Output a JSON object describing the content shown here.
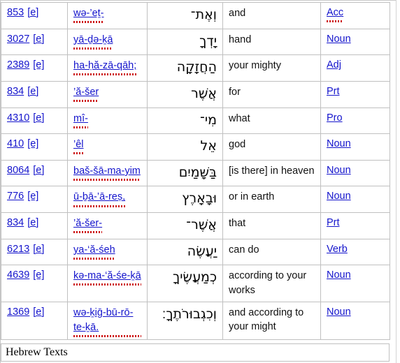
{
  "document": {
    "title": "Hebrew Texts",
    "footer_label": "Hebrew Texts"
  },
  "colors": {
    "link": "#1414CC",
    "text": "#000000",
    "border": "#C0C0C0",
    "spellcheck_underline": "#CC1111",
    "background": "#FFFFFF"
  },
  "table": {
    "columns": [
      "strongs",
      "transliteration",
      "hebrew",
      "gloss",
      "part_of_speech"
    ],
    "rows": [
      {
        "strongs": "853",
        "strongs_suffix": "[e]",
        "transliteration": "wə-’eṯ-",
        "hebrew": "וְאֶת־",
        "gloss": "and",
        "pos": "Acc"
      },
      {
        "strongs": "3027",
        "strongs_suffix": "[e]",
        "transliteration": "yā-ḏə-ḵā",
        "hebrew": "יָדְךָ",
        "gloss": "hand",
        "pos": "Noun"
      },
      {
        "strongs": "2389",
        "strongs_suffix": "[e]",
        "transliteration": "ha-ḥă-zā-qāh;",
        "hebrew": "הַחֲזָקָה",
        "gloss": "your mighty",
        "pos": "Adj"
      },
      {
        "strongs": "834",
        "strongs_suffix": "[e]",
        "transliteration": "’ă-šer",
        "hebrew": "אֲשֶׁר",
        "gloss": "for",
        "pos": "Prt"
      },
      {
        "strongs": "4310",
        "strongs_suffix": "[e]",
        "transliteration": "mî-",
        "hebrew": "מִי־",
        "gloss": "what",
        "pos": "Pro"
      },
      {
        "strongs": "410",
        "strongs_suffix": "[e]",
        "transliteration": "’êl",
        "hebrew": "אֵל",
        "gloss": "god",
        "pos": "Noun"
      },
      {
        "strongs": "8064",
        "strongs_suffix": "[e]",
        "transliteration": "baš-šā-ma-yim",
        "hebrew": "בַּשָּׁמַיִם",
        "gloss": "[is there] in heaven",
        "pos": "Noun"
      },
      {
        "strongs": "776",
        "strongs_suffix": "[e]",
        "transliteration": "ū-ḇā-’ā-reṣ,",
        "hebrew": "וּבָאָרֶץ",
        "gloss": "or in earth",
        "pos": "Noun"
      },
      {
        "strongs": "834",
        "strongs_suffix": "[e]",
        "transliteration": "’ă-šer-",
        "hebrew": "אֲשֶׁר־",
        "gloss": "that",
        "pos": "Prt"
      },
      {
        "strongs": "6213",
        "strongs_suffix": "[e]",
        "transliteration": "ya-‘ă-śeh",
        "hebrew": "יַעֲשֶׂה",
        "gloss": "can do",
        "pos": "Verb"
      },
      {
        "strongs": "4639",
        "strongs_suffix": "[e]",
        "transliteration": "kə-ma-‘ă-śe-ḵā",
        "hebrew": "כְמַעֲשֶׂיךָ",
        "gloss": "according to your works",
        "pos": "Noun"
      },
      {
        "strongs": "1369",
        "strongs_suffix": "[e]",
        "transliteration": "wə-ḵiḡ-bū-rō-te-ḵā.",
        "hebrew": "וְכִגְבוּרֹתֶךָ׃",
        "gloss": "and according to your might",
        "pos": "Noun"
      }
    ]
  }
}
